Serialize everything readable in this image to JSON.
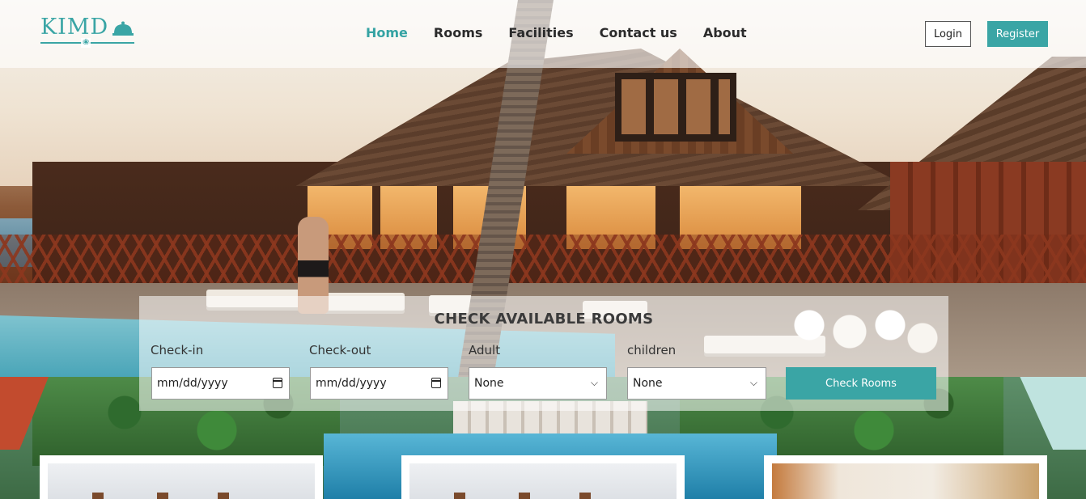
{
  "brand": {
    "name": "KIMD"
  },
  "nav": {
    "links": [
      {
        "label": "Home",
        "active": true
      },
      {
        "label": "Rooms",
        "active": false
      },
      {
        "label": "Facilities",
        "active": false
      },
      {
        "label": "Contact us",
        "active": false
      },
      {
        "label": "About",
        "active": false
      }
    ],
    "login_label": "Login",
    "register_label": "Register"
  },
  "booking": {
    "title": "CHECK AVAILABLE ROOMS",
    "checkin_label": "Check-in",
    "checkin_value": "mm/dd/yyyy",
    "checkout_label": "Check-out",
    "checkout_value": "mm/dd/yyyy",
    "adult_label": "Adult",
    "adult_value": "None",
    "children_label": "children",
    "children_value": "None",
    "submit_label": "Check Rooms"
  },
  "colors": {
    "accent": "#3aa5a5",
    "text": "#2b2b2b"
  },
  "icons": [
    "calendar-icon",
    "chevron-down-icon",
    "bell-icon",
    "lotus-icon"
  ]
}
